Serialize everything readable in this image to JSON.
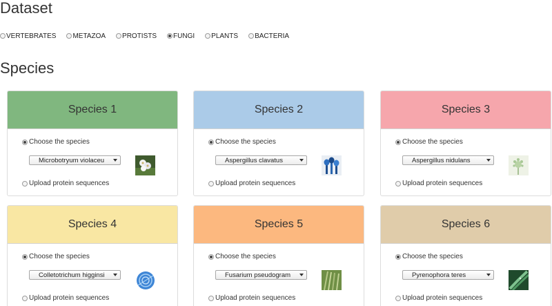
{
  "dataset": {
    "title": "Dataset",
    "options": [
      {
        "label": "VERTEBRATES",
        "checked": false
      },
      {
        "label": "METAZOA",
        "checked": false
      },
      {
        "label": "PROTISTS",
        "checked": false
      },
      {
        "label": "FUNGI",
        "checked": true
      },
      {
        "label": "PLANTS",
        "checked": false
      },
      {
        "label": "BACTERIA",
        "checked": false
      }
    ]
  },
  "species": {
    "title": "Species",
    "choose_label": "Choose the species",
    "upload_label": "Upload protein sequences",
    "cards": [
      {
        "title": "Species 1",
        "header_color": "#80b77f",
        "selected": "Microbotryum violaceu",
        "thumb_icon": "white-flower-icon"
      },
      {
        "title": "Species 2",
        "header_color": "#abcbe8",
        "selected": "Aspergillus clavatus",
        "thumb_icon": "blue-spores-icon"
      },
      {
        "title": "Species 3",
        "header_color": "#f6a6ac",
        "selected": "Aspergillus nidulans",
        "thumb_icon": "microscope-spore-icon"
      },
      {
        "title": "Species 4",
        "header_color": "#f9e7a3",
        "selected": "Colletotrichum higginsi",
        "thumb_icon": "blue-mycelium-icon"
      },
      {
        "title": "Species 5",
        "header_color": "#fcb87f",
        "selected": "Fusarium pseudogram",
        "thumb_icon": "wheat-icon"
      },
      {
        "title": "Species 6",
        "header_color": "#e0ccaa",
        "selected": "Pyrenophora teres",
        "thumb_icon": "green-leaf-icon"
      }
    ]
  }
}
